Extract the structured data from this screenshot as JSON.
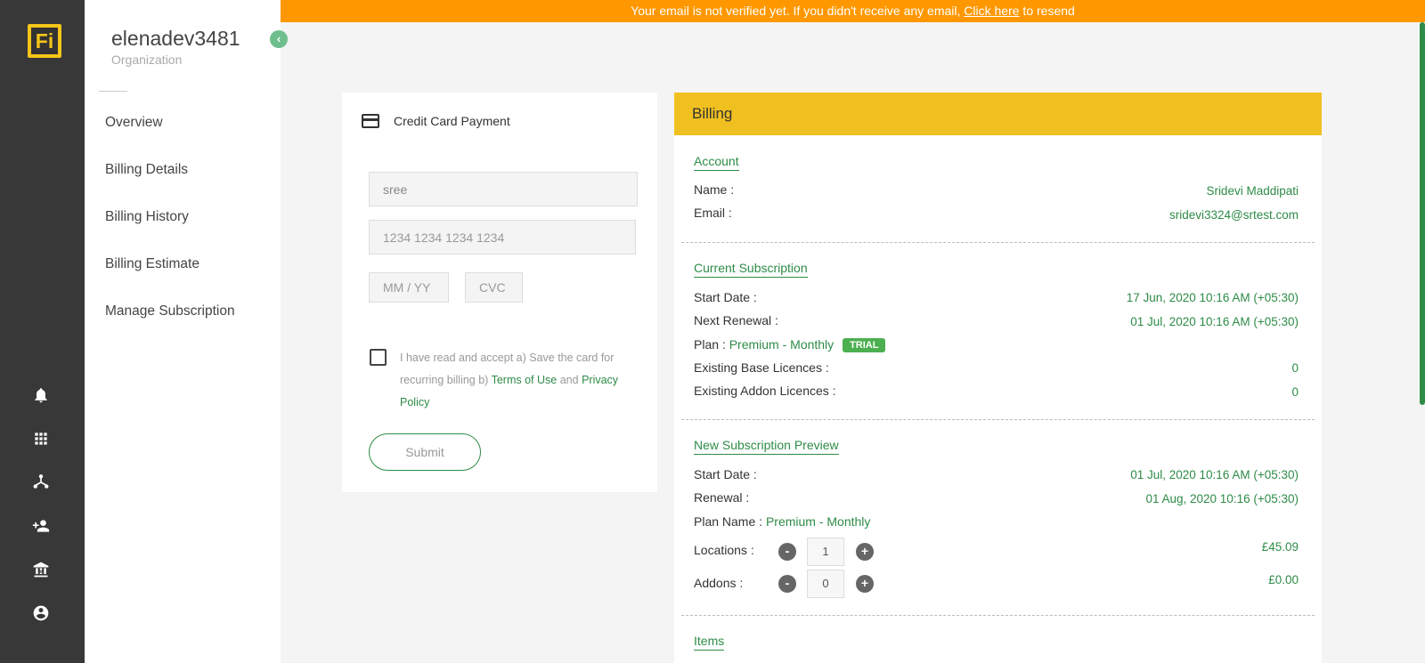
{
  "app": {
    "logo_text": "Fi"
  },
  "rail": {
    "icons": [
      "bell-icon",
      "apps-grid-icon",
      "network-icon",
      "add-user-icon",
      "bank-icon",
      "account-circle-icon"
    ]
  },
  "sidebar": {
    "org_name": "elenadev3481",
    "org_type": "Organization",
    "collapse_glyph": "‹",
    "items": [
      {
        "label": "Overview"
      },
      {
        "label": "Billing Details"
      },
      {
        "label": "Billing History"
      },
      {
        "label": "Billing Estimate"
      },
      {
        "label": "Manage Subscription"
      }
    ]
  },
  "banner": {
    "text_before": "Your email is not verified yet. If you didn't receive any email, ",
    "link": "Click here",
    "text_after": " to resend"
  },
  "payment": {
    "title": "Credit Card Payment",
    "name_value": "sree",
    "card_placeholder": "1234 1234 1234 1234",
    "expiry_placeholder": "MM / YY",
    "cvc_placeholder": "CVC",
    "terms_text_1": "I have read and accept a) Save the card for recurring billing b) ",
    "terms_link": "Terms of Use",
    "terms_and": " and ",
    "privacy_link": "Privacy Policy",
    "submit_label": "Submit"
  },
  "billing": {
    "title": "Billing",
    "account": {
      "title": "Account",
      "name_label": "Name :",
      "name_value": "Sridevi Maddipati",
      "email_label": "Email :",
      "email_value": "sridevi3324@srtest.com"
    },
    "current": {
      "title": "Current Subscription",
      "start_label": "Start Date :",
      "start_value": "17 Jun, 2020 10:16 AM (+05:30)",
      "renewal_label": "Next Renewal :",
      "renewal_value": "01 Jul, 2020 10:16 AM (+05:30)",
      "plan_label": "Plan :",
      "plan_value": "Premium - Monthly",
      "plan_badge": "TRIAL",
      "base_label": "Existing Base Licences :",
      "base_value": "0",
      "addon_label": "Existing Addon Licences :",
      "addon_value": "0"
    },
    "preview": {
      "title": "New Subscription Preview",
      "start_label": "Start Date :",
      "start_value": "01 Jul, 2020 10:16 AM (+05:30)",
      "renewal_label": "Renewal :",
      "renewal_value": "01 Aug, 2020 10:16 (+05:30)",
      "plan_label": "Plan Name :",
      "plan_value": "Premium - Monthly",
      "locations_label": "Locations :",
      "locations_qty": "1",
      "locations_price": "£45.09",
      "addons_label": "Addons :",
      "addons_qty": "0",
      "addons_price": "£0.00",
      "minus_glyph": "-",
      "plus_glyph": "+"
    },
    "items": {
      "title": "Items"
    }
  },
  "colors": {
    "rail_bg": "#383838",
    "banner_bg": "#ff9800",
    "billing_header_bg": "#f0c020",
    "accent_green": "#2e8b47",
    "badge_green": "#4caf50"
  }
}
